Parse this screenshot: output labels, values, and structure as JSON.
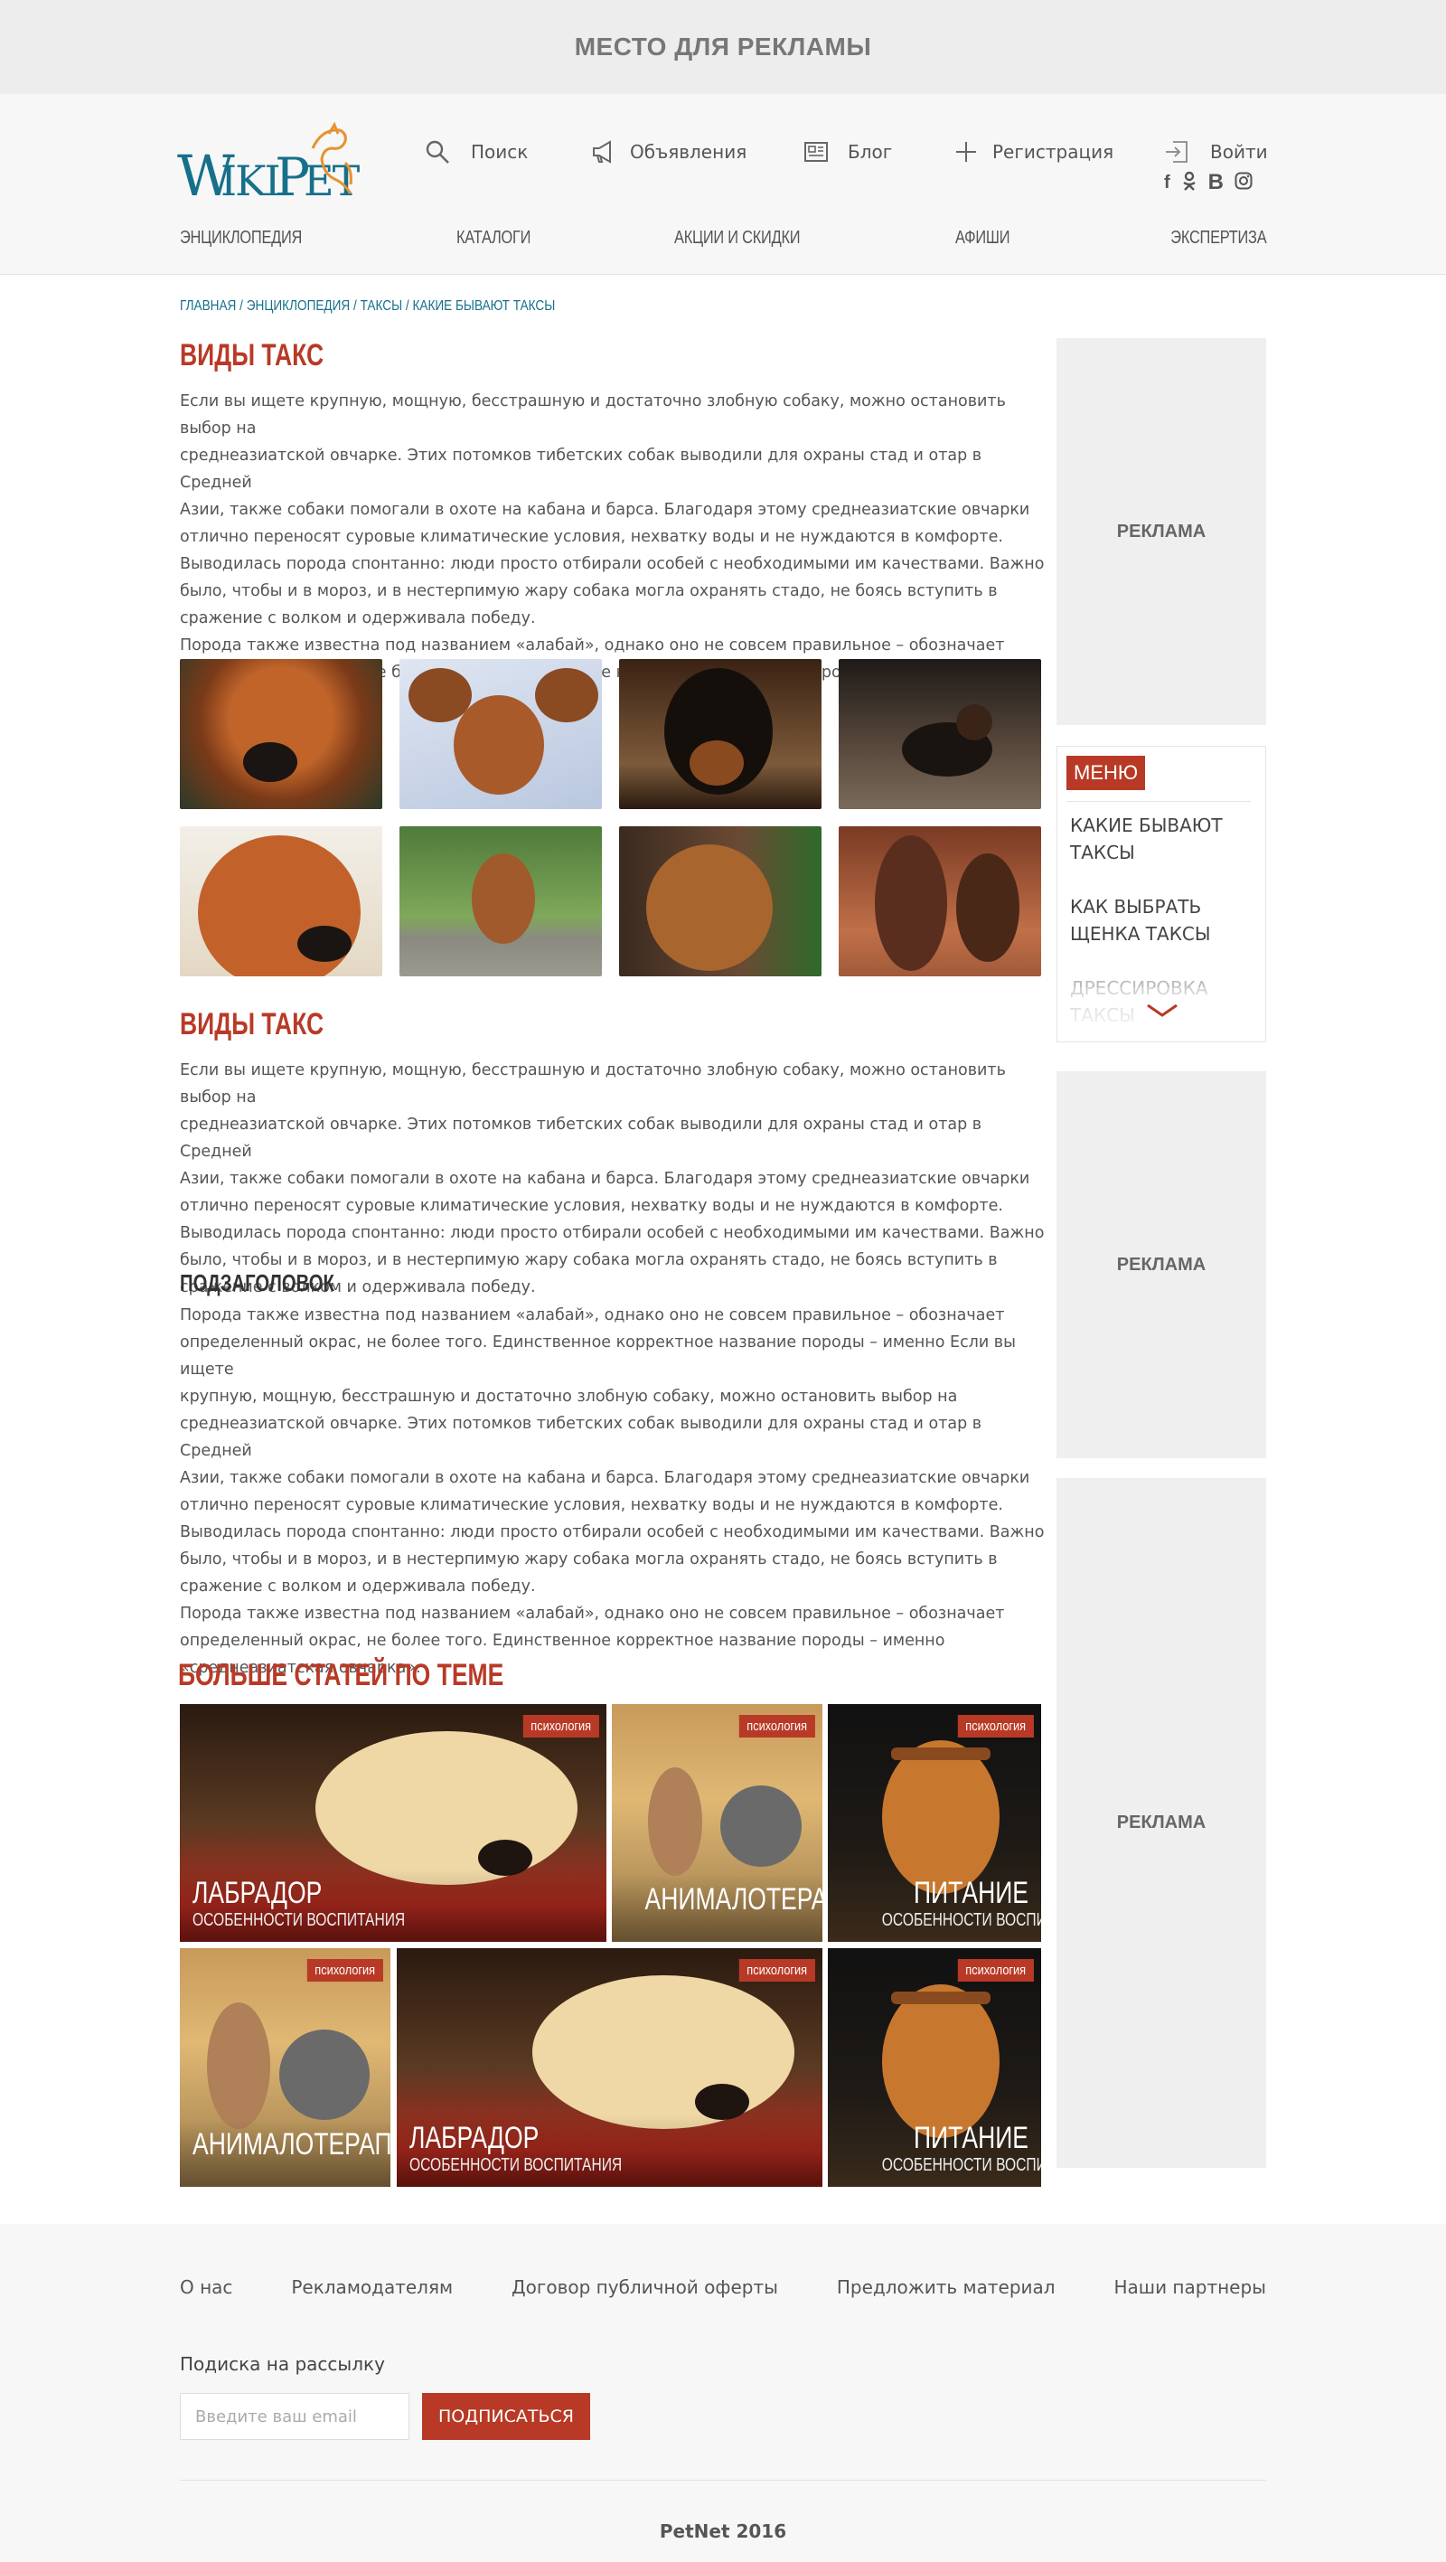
{
  "top_ad": {
    "label": "МЕСТО ДЛЯ РЕКЛАМЫ"
  },
  "header": {
    "logo_text": "WikiPet",
    "nav": {
      "search": "Поиск",
      "ads": "Объявления",
      "blog": "Блог",
      "register": "Регистрация",
      "login": "Войти"
    },
    "social": [
      "f",
      "ok",
      "B",
      "ig"
    ],
    "menu": [
      "ЭНЦИКЛОПЕДИЯ",
      "КАТАЛОГИ",
      "АКЦИИ И СКИДКИ",
      "АФИШИ",
      "ЭКСПЕРТИЗА"
    ]
  },
  "breadcrumb": "ГЛАВНАЯ / ЭНЦИКЛОПЕДИЯ / ТАКСЫ / КАКИЕ БЫВАЮТ ТАКСЫ",
  "section1": {
    "title": "ВИДЫ ТАКС",
    "lines": [
      "Если вы ищете крупную, мощную, бесстрашную и достаточно злобную собаку, можно остановить выбор на",
      "среднеазиатской овчарке. Этих потомков тибетских собак выводили для охраны стад и отар в Средней",
      "Азии, также собаки помогали в охоте на кабана и барса. Благодаря этому среднеазиатские овчарки",
      "отлично переносят суровые климатические условия, нехватку воды и не нуждаются в комфорте.",
      "Выводилась порода спонтанно: люди просто отбирали особей с необходимыми им качествами. Важно",
      "было, чтобы и в мороз, и в нестерпимую жару собака могла охранять стадо, не боясь вступить в",
      "сражение с волком и одерживала победу.",
      "Порода также известна под названием «алабай», однако оно не совсем правильное – обозначает",
      "определенный окрас, не более того. Единственное корректное название породы – именно"
    ]
  },
  "section2": {
    "title": "ВИДЫ ТАКС",
    "lines": [
      "Если вы ищете крупную, мощную, бесстрашную и достаточно злобную собаку, можно остановить выбор на",
      "среднеазиатской овчарке. Этих потомков тибетских собак выводили для охраны стад и отар в Средней",
      "Азии, также собаки помогали в охоте на кабана и барса. Благодаря этому среднеазиатские овчарки",
      "отлично переносят суровые климатические условия, нехватку воды и не нуждаются в комфорте.",
      "Выводилась порода спонтанно: люди просто отбирали особей с необходимыми им качествами. Важно",
      "было, чтобы и в мороз, и в нестерпимую жару собака могла охранять стадо, не боясь вступить в",
      "сражение с волком и одерживала победу."
    ],
    "subtitle": "ПОДЗАГОЛОВОК",
    "lines2": [
      "Порода также известна под названием «алабай», однако оно не совсем правильное – обозначает",
      "определенный окрас, не более того. Единственное корректное название породы – именно Если вы ищете",
      "крупную, мощную, бесстрашную и достаточно злобную собаку, можно остановить выбор на",
      "среднеазиатской овчарке. Этих потомков тибетских собак выводили для охраны стад и отар в Средней",
      "Азии, также собаки помогали в охоте на кабана и барса. Благодаря этому среднеазиатские овчарки",
      "отлично переносят суровые климатические условия, нехватку воды и не нуждаются в комфорте.",
      "Выводилась порода спонтанно: люди просто отбирали особей с необходимыми им качествами. Важно",
      "было, чтобы и в мороз, и в нестерпимую жару собака могла охранять стадо, не боясь вступить в",
      "сражение с волком и одерживала победу.",
      "Порода также известна под названием «алабай», однако оно не совсем правильное – обозначает",
      "определенный окрас, не более того. Единственное корректное название породы – именно",
      "«среднеазиатская овчарка»."
    ]
  },
  "more_articles": {
    "title": "БОЛЬШЕ СТАТЕЙ ПО ТЕМЕ",
    "cards": [
      {
        "tag": "психология",
        "title": "ЛАБРАДОР",
        "sub": "ОСОБЕННОСТИ ВОСПИТАНИЯ"
      },
      {
        "tag": "психология",
        "title": "АНИМАЛОТЕРАПИЯ",
        "sub": ""
      },
      {
        "tag": "психология",
        "title": "ПИТАНИЕ",
        "sub": "ОСОБЕННОСТИ ВОСПИТАНИЯ"
      },
      {
        "tag": "психология",
        "title": "АНИМАЛОТЕРАПИЯ",
        "sub": ""
      },
      {
        "tag": "психология",
        "title": "ЛАБРАДОР",
        "sub": "ОСОБЕННОСТИ ВОСПИТАНИЯ"
      },
      {
        "tag": "психология",
        "title": "ПИТАНИЕ",
        "sub": "ОСОБЕННОСТИ ВОСПИТАНИЯ"
      }
    ]
  },
  "sidebar": {
    "ad_label": "РЕКЛАМА",
    "menu_badge": "МЕНЮ",
    "menu_items": [
      "КАКИЕ БЫВАЮТ ТАКСЫ",
      "КАК ВЫБРАТЬ ЩЕНКА ТАКСЫ",
      "ДРЕССИРОВКА ТАКСЫ"
    ]
  },
  "footer": {
    "links": [
      "О нас",
      "Рекламодателям",
      "Договор публичной оферты",
      "Предложить материал",
      "Наши партнеры"
    ],
    "subscribe_label": "Подиска на рассылку",
    "email_placeholder": "Введите ваш email",
    "subscribe_button": "ПОДПИСАТЬСЯ",
    "copyright": "PetNet 2016"
  },
  "colors": {
    "accent": "#b83a26",
    "brand": "#16708a",
    "ad_bg": "#efefef"
  }
}
